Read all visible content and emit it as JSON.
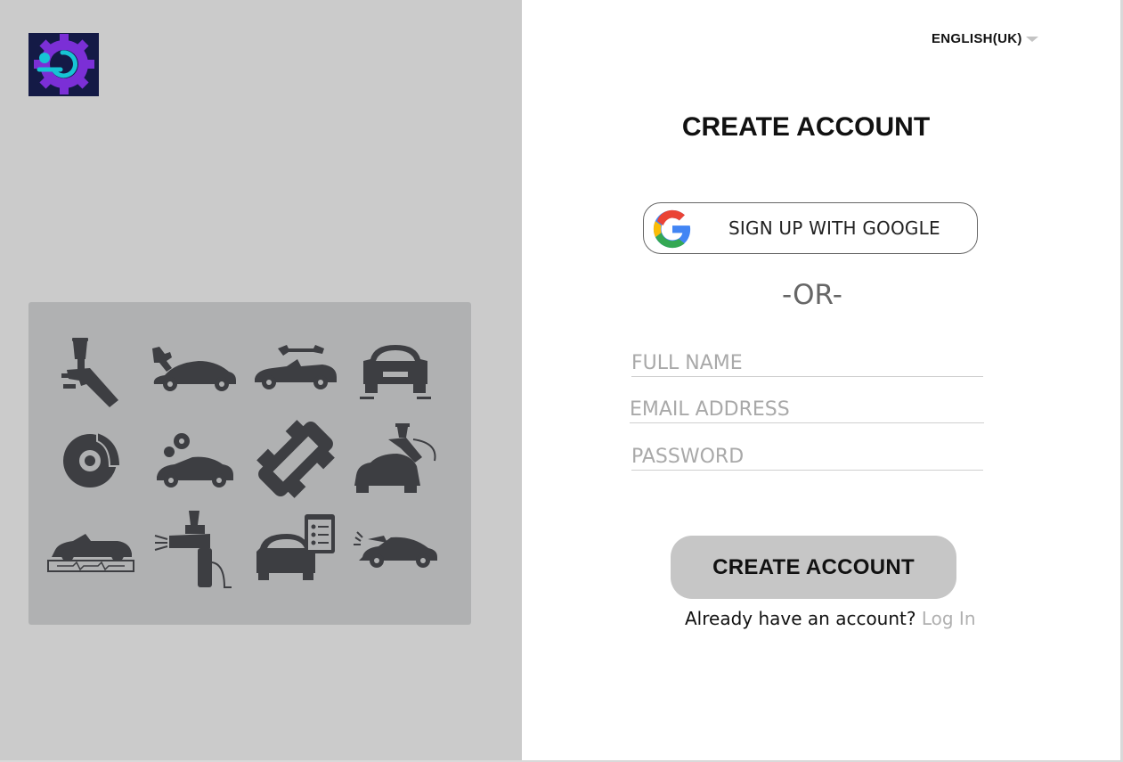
{
  "header": {
    "language_label": "ENGLISH(UK)",
    "logo_icon": "gear-power-logo-icon"
  },
  "illustration": {
    "icons": [
      "spray-gun-icon",
      "car-repair-wrench-icon",
      "convertible-wrench-icon",
      "car-front-alignment-icon",
      "brake-disc-icon",
      "car-gears-icon",
      "car-chassis-icon",
      "car-paint-spray-icon",
      "convertible-diagnostic-icon",
      "paint-gun-icon",
      "car-checklist-icon",
      "car-open-hood-icon"
    ]
  },
  "form": {
    "title": "CREATE ACCOUNT",
    "google_button_label": "SIGN UP WITH GOOGLE",
    "or_divider": "-OR-",
    "full_name_placeholder": "FULL NAME",
    "email_placeholder": "EMAIL ADDRESS",
    "password_placeholder": "PASSWORD",
    "submit_label": "CREATE ACCOUNT",
    "already_text": "Already have an account?",
    "login_link": "Log In"
  },
  "colors": {
    "left_panel": "#cbcbcb",
    "illustration_bg": "#b0b1b2",
    "icon_fill": "#3d3e42",
    "submit_bg": "#c6c6c6",
    "logo_bg": "#141a46",
    "logo_gear": "#7b2fd6",
    "logo_accent": "#17c4d4"
  }
}
